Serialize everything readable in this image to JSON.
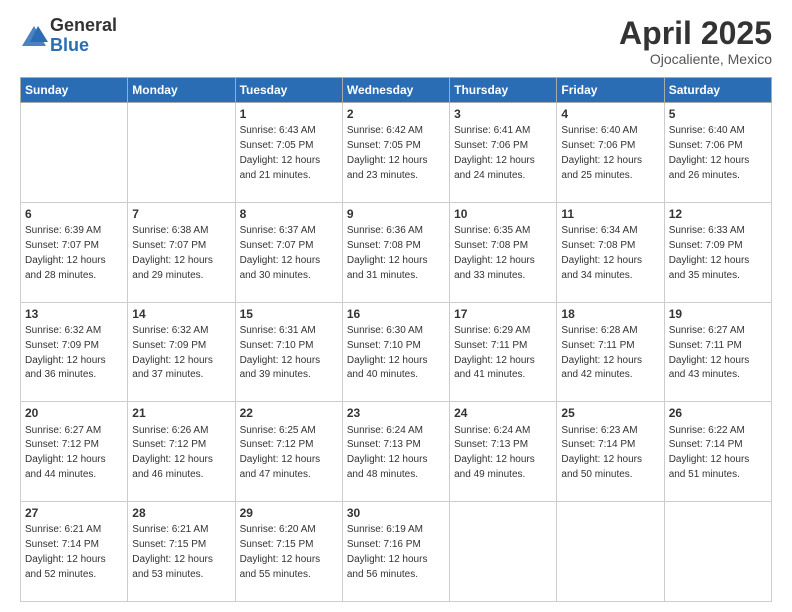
{
  "logo": {
    "general": "General",
    "blue": "Blue"
  },
  "header": {
    "month": "April 2025",
    "location": "Ojocaliente, Mexico"
  },
  "weekdays": [
    "Sunday",
    "Monday",
    "Tuesday",
    "Wednesday",
    "Thursday",
    "Friday",
    "Saturday"
  ],
  "weeks": [
    [
      {
        "day": "",
        "info": ""
      },
      {
        "day": "",
        "info": ""
      },
      {
        "day": "1",
        "info": "Sunrise: 6:43 AM\nSunset: 7:05 PM\nDaylight: 12 hours and 21 minutes."
      },
      {
        "day": "2",
        "info": "Sunrise: 6:42 AM\nSunset: 7:05 PM\nDaylight: 12 hours and 23 minutes."
      },
      {
        "day": "3",
        "info": "Sunrise: 6:41 AM\nSunset: 7:06 PM\nDaylight: 12 hours and 24 minutes."
      },
      {
        "day": "4",
        "info": "Sunrise: 6:40 AM\nSunset: 7:06 PM\nDaylight: 12 hours and 25 minutes."
      },
      {
        "day": "5",
        "info": "Sunrise: 6:40 AM\nSunset: 7:06 PM\nDaylight: 12 hours and 26 minutes."
      }
    ],
    [
      {
        "day": "6",
        "info": "Sunrise: 6:39 AM\nSunset: 7:07 PM\nDaylight: 12 hours and 28 minutes."
      },
      {
        "day": "7",
        "info": "Sunrise: 6:38 AM\nSunset: 7:07 PM\nDaylight: 12 hours and 29 minutes."
      },
      {
        "day": "8",
        "info": "Sunrise: 6:37 AM\nSunset: 7:07 PM\nDaylight: 12 hours and 30 minutes."
      },
      {
        "day": "9",
        "info": "Sunrise: 6:36 AM\nSunset: 7:08 PM\nDaylight: 12 hours and 31 minutes."
      },
      {
        "day": "10",
        "info": "Sunrise: 6:35 AM\nSunset: 7:08 PM\nDaylight: 12 hours and 33 minutes."
      },
      {
        "day": "11",
        "info": "Sunrise: 6:34 AM\nSunset: 7:08 PM\nDaylight: 12 hours and 34 minutes."
      },
      {
        "day": "12",
        "info": "Sunrise: 6:33 AM\nSunset: 7:09 PM\nDaylight: 12 hours and 35 minutes."
      }
    ],
    [
      {
        "day": "13",
        "info": "Sunrise: 6:32 AM\nSunset: 7:09 PM\nDaylight: 12 hours and 36 minutes."
      },
      {
        "day": "14",
        "info": "Sunrise: 6:32 AM\nSunset: 7:09 PM\nDaylight: 12 hours and 37 minutes."
      },
      {
        "day": "15",
        "info": "Sunrise: 6:31 AM\nSunset: 7:10 PM\nDaylight: 12 hours and 39 minutes."
      },
      {
        "day": "16",
        "info": "Sunrise: 6:30 AM\nSunset: 7:10 PM\nDaylight: 12 hours and 40 minutes."
      },
      {
        "day": "17",
        "info": "Sunrise: 6:29 AM\nSunset: 7:11 PM\nDaylight: 12 hours and 41 minutes."
      },
      {
        "day": "18",
        "info": "Sunrise: 6:28 AM\nSunset: 7:11 PM\nDaylight: 12 hours and 42 minutes."
      },
      {
        "day": "19",
        "info": "Sunrise: 6:27 AM\nSunset: 7:11 PM\nDaylight: 12 hours and 43 minutes."
      }
    ],
    [
      {
        "day": "20",
        "info": "Sunrise: 6:27 AM\nSunset: 7:12 PM\nDaylight: 12 hours and 44 minutes."
      },
      {
        "day": "21",
        "info": "Sunrise: 6:26 AM\nSunset: 7:12 PM\nDaylight: 12 hours and 46 minutes."
      },
      {
        "day": "22",
        "info": "Sunrise: 6:25 AM\nSunset: 7:12 PM\nDaylight: 12 hours and 47 minutes."
      },
      {
        "day": "23",
        "info": "Sunrise: 6:24 AM\nSunset: 7:13 PM\nDaylight: 12 hours and 48 minutes."
      },
      {
        "day": "24",
        "info": "Sunrise: 6:24 AM\nSunset: 7:13 PM\nDaylight: 12 hours and 49 minutes."
      },
      {
        "day": "25",
        "info": "Sunrise: 6:23 AM\nSunset: 7:14 PM\nDaylight: 12 hours and 50 minutes."
      },
      {
        "day": "26",
        "info": "Sunrise: 6:22 AM\nSunset: 7:14 PM\nDaylight: 12 hours and 51 minutes."
      }
    ],
    [
      {
        "day": "27",
        "info": "Sunrise: 6:21 AM\nSunset: 7:14 PM\nDaylight: 12 hours and 52 minutes."
      },
      {
        "day": "28",
        "info": "Sunrise: 6:21 AM\nSunset: 7:15 PM\nDaylight: 12 hours and 53 minutes."
      },
      {
        "day": "29",
        "info": "Sunrise: 6:20 AM\nSunset: 7:15 PM\nDaylight: 12 hours and 55 minutes."
      },
      {
        "day": "30",
        "info": "Sunrise: 6:19 AM\nSunset: 7:16 PM\nDaylight: 12 hours and 56 minutes."
      },
      {
        "day": "",
        "info": ""
      },
      {
        "day": "",
        "info": ""
      },
      {
        "day": "",
        "info": ""
      }
    ]
  ]
}
